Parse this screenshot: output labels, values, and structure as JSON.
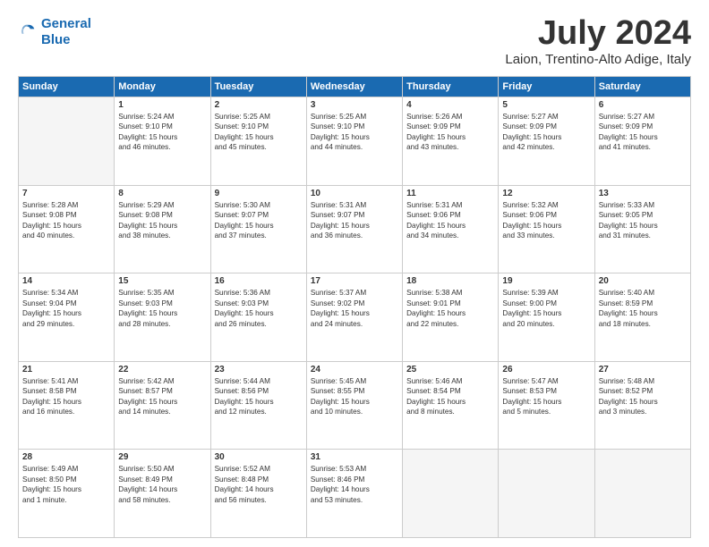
{
  "logo": {
    "line1": "General",
    "line2": "Blue"
  },
  "title": "July 2024",
  "location": "Laion, Trentino-Alto Adige, Italy",
  "days_header": [
    "Sunday",
    "Monday",
    "Tuesday",
    "Wednesday",
    "Thursday",
    "Friday",
    "Saturday"
  ],
  "weeks": [
    [
      {
        "day": "",
        "info": ""
      },
      {
        "day": "1",
        "info": "Sunrise: 5:24 AM\nSunset: 9:10 PM\nDaylight: 15 hours\nand 46 minutes."
      },
      {
        "day": "2",
        "info": "Sunrise: 5:25 AM\nSunset: 9:10 PM\nDaylight: 15 hours\nand 45 minutes."
      },
      {
        "day": "3",
        "info": "Sunrise: 5:25 AM\nSunset: 9:10 PM\nDaylight: 15 hours\nand 44 minutes."
      },
      {
        "day": "4",
        "info": "Sunrise: 5:26 AM\nSunset: 9:09 PM\nDaylight: 15 hours\nand 43 minutes."
      },
      {
        "day": "5",
        "info": "Sunrise: 5:27 AM\nSunset: 9:09 PM\nDaylight: 15 hours\nand 42 minutes."
      },
      {
        "day": "6",
        "info": "Sunrise: 5:27 AM\nSunset: 9:09 PM\nDaylight: 15 hours\nand 41 minutes."
      }
    ],
    [
      {
        "day": "7",
        "info": "Sunrise: 5:28 AM\nSunset: 9:08 PM\nDaylight: 15 hours\nand 40 minutes."
      },
      {
        "day": "8",
        "info": "Sunrise: 5:29 AM\nSunset: 9:08 PM\nDaylight: 15 hours\nand 38 minutes."
      },
      {
        "day": "9",
        "info": "Sunrise: 5:30 AM\nSunset: 9:07 PM\nDaylight: 15 hours\nand 37 minutes."
      },
      {
        "day": "10",
        "info": "Sunrise: 5:31 AM\nSunset: 9:07 PM\nDaylight: 15 hours\nand 36 minutes."
      },
      {
        "day": "11",
        "info": "Sunrise: 5:31 AM\nSunset: 9:06 PM\nDaylight: 15 hours\nand 34 minutes."
      },
      {
        "day": "12",
        "info": "Sunrise: 5:32 AM\nSunset: 9:06 PM\nDaylight: 15 hours\nand 33 minutes."
      },
      {
        "day": "13",
        "info": "Sunrise: 5:33 AM\nSunset: 9:05 PM\nDaylight: 15 hours\nand 31 minutes."
      }
    ],
    [
      {
        "day": "14",
        "info": "Sunrise: 5:34 AM\nSunset: 9:04 PM\nDaylight: 15 hours\nand 29 minutes."
      },
      {
        "day": "15",
        "info": "Sunrise: 5:35 AM\nSunset: 9:03 PM\nDaylight: 15 hours\nand 28 minutes."
      },
      {
        "day": "16",
        "info": "Sunrise: 5:36 AM\nSunset: 9:03 PM\nDaylight: 15 hours\nand 26 minutes."
      },
      {
        "day": "17",
        "info": "Sunrise: 5:37 AM\nSunset: 9:02 PM\nDaylight: 15 hours\nand 24 minutes."
      },
      {
        "day": "18",
        "info": "Sunrise: 5:38 AM\nSunset: 9:01 PM\nDaylight: 15 hours\nand 22 minutes."
      },
      {
        "day": "19",
        "info": "Sunrise: 5:39 AM\nSunset: 9:00 PM\nDaylight: 15 hours\nand 20 minutes."
      },
      {
        "day": "20",
        "info": "Sunrise: 5:40 AM\nSunset: 8:59 PM\nDaylight: 15 hours\nand 18 minutes."
      }
    ],
    [
      {
        "day": "21",
        "info": "Sunrise: 5:41 AM\nSunset: 8:58 PM\nDaylight: 15 hours\nand 16 minutes."
      },
      {
        "day": "22",
        "info": "Sunrise: 5:42 AM\nSunset: 8:57 PM\nDaylight: 15 hours\nand 14 minutes."
      },
      {
        "day": "23",
        "info": "Sunrise: 5:44 AM\nSunset: 8:56 PM\nDaylight: 15 hours\nand 12 minutes."
      },
      {
        "day": "24",
        "info": "Sunrise: 5:45 AM\nSunset: 8:55 PM\nDaylight: 15 hours\nand 10 minutes."
      },
      {
        "day": "25",
        "info": "Sunrise: 5:46 AM\nSunset: 8:54 PM\nDaylight: 15 hours\nand 8 minutes."
      },
      {
        "day": "26",
        "info": "Sunrise: 5:47 AM\nSunset: 8:53 PM\nDaylight: 15 hours\nand 5 minutes."
      },
      {
        "day": "27",
        "info": "Sunrise: 5:48 AM\nSunset: 8:52 PM\nDaylight: 15 hours\nand 3 minutes."
      }
    ],
    [
      {
        "day": "28",
        "info": "Sunrise: 5:49 AM\nSunset: 8:50 PM\nDaylight: 15 hours\nand 1 minute."
      },
      {
        "day": "29",
        "info": "Sunrise: 5:50 AM\nSunset: 8:49 PM\nDaylight: 14 hours\nand 58 minutes."
      },
      {
        "day": "30",
        "info": "Sunrise: 5:52 AM\nSunset: 8:48 PM\nDaylight: 14 hours\nand 56 minutes."
      },
      {
        "day": "31",
        "info": "Sunrise: 5:53 AM\nSunset: 8:46 PM\nDaylight: 14 hours\nand 53 minutes."
      },
      {
        "day": "",
        "info": ""
      },
      {
        "day": "",
        "info": ""
      },
      {
        "day": "",
        "info": ""
      }
    ]
  ]
}
